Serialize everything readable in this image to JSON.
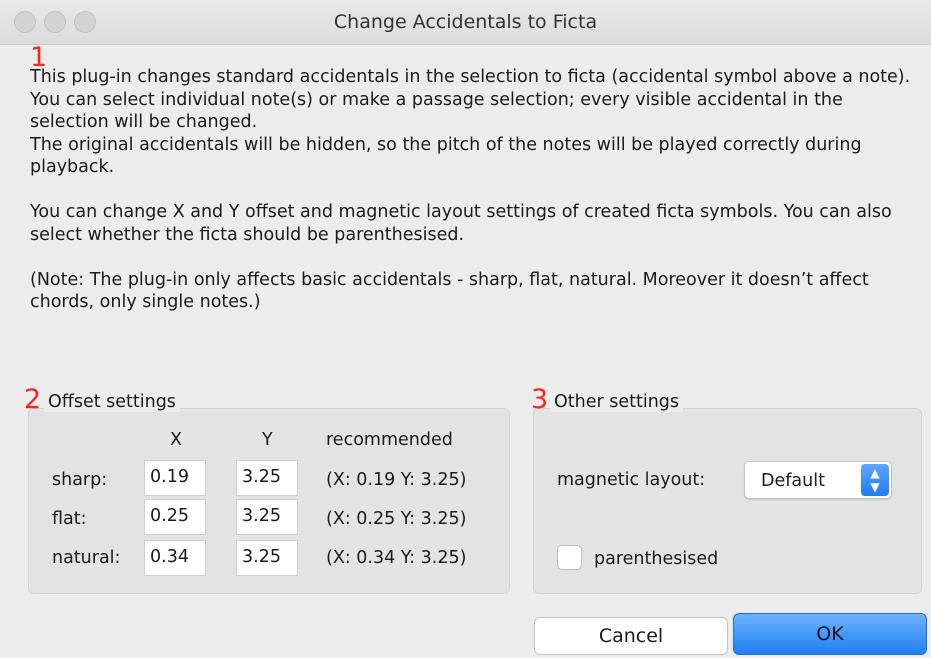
{
  "window": {
    "title": "Change Accidentals to Ficta"
  },
  "markers": {
    "m1": "1",
    "m2": "2",
    "m3": "3"
  },
  "description": {
    "p1": "This plug-in changes standard accidentals in the selection to ficta (accidental symbol above a note). You can select individual note(s) or make a passage selection; every visible accidental in the selection will be changed.",
    "p2": "The original accidentals will be hidden, so the pitch of the notes will be played correctly during playback.",
    "p3": "You can change X and Y offset and magnetic layout settings of created ficta symbols. You can also select whether the ficta should be parenthesised.",
    "p4": "(Note: The plug-in only affects basic accidentals - sharp, flat, natural. Moreover it doesn’t affect chords, only single notes.)"
  },
  "offset_settings": {
    "label": "Offset settings",
    "headers": {
      "x": "X",
      "y": "Y",
      "recommended": "recommended"
    },
    "rows": [
      {
        "label": "sharp:",
        "x": "0.19",
        "y": "3.25",
        "recommended": "(X: 0.19 Y: 3.25)"
      },
      {
        "label": "flat:",
        "x": "0.25",
        "y": "3.25",
        "recommended": "(X: 0.25 Y: 3.25)"
      },
      {
        "label": "natural:",
        "x": "0.34",
        "y": "3.25",
        "recommended": "(X: 0.34 Y: 3.25)"
      }
    ]
  },
  "other_settings": {
    "label": "Other settings",
    "magnetic_layout_label": "magnetic layout:",
    "magnetic_layout_value": "Default",
    "parenthesised_label": "parenthesised",
    "parenthesised_checked": false
  },
  "buttons": {
    "cancel": "Cancel",
    "ok": "OK"
  },
  "colors": {
    "marker": "#f0281e",
    "accent": "#1f7ff3"
  }
}
